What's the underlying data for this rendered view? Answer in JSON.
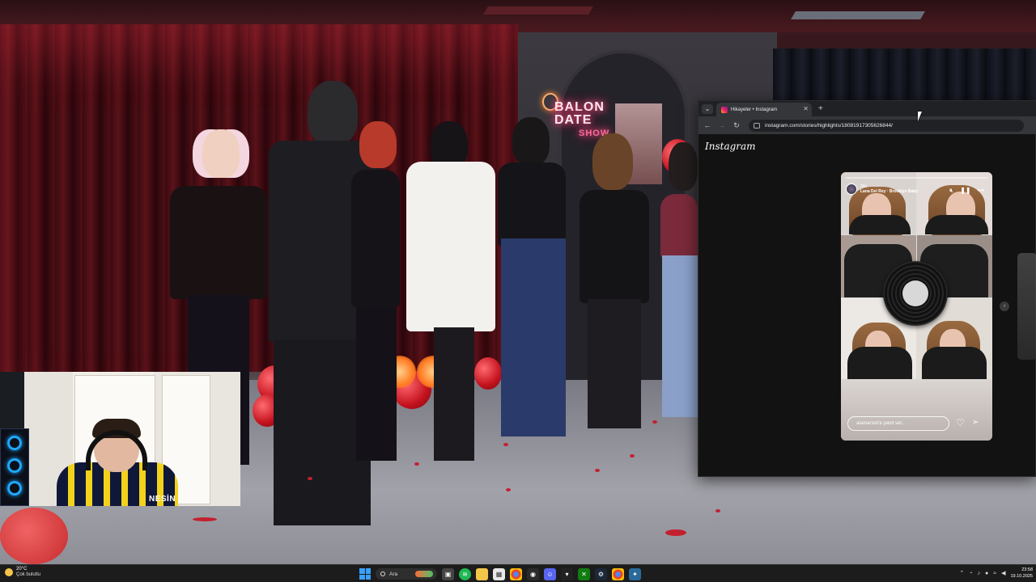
{
  "scene": {
    "neon_line1": "BALON DATE",
    "neon_line2": "SHOW"
  },
  "webcam": {
    "jersey_text": "NESİN"
  },
  "browser": {
    "tab_title": "Hikayeler • Instagram",
    "url": "instagram.com/stories/highlights/18081917305626844/",
    "page_logo": "Instagram",
    "story": {
      "time": "35h",
      "song": "Lana Del Rey · Brooklyn Baby",
      "reply_placeholder": "asenarsist'e yanıt ver..."
    }
  },
  "taskbar": {
    "weather_temp": "20°C",
    "weather_desc": "Çok bulutlu",
    "search_label": "Ara",
    "time": "23:58",
    "date": "19.10.2025"
  },
  "colors": {
    "curtain": "#4e0f16",
    "neon": "#ff2a6a",
    "taskbar": "#1c1c1c",
    "browser_bg": "#121212"
  }
}
